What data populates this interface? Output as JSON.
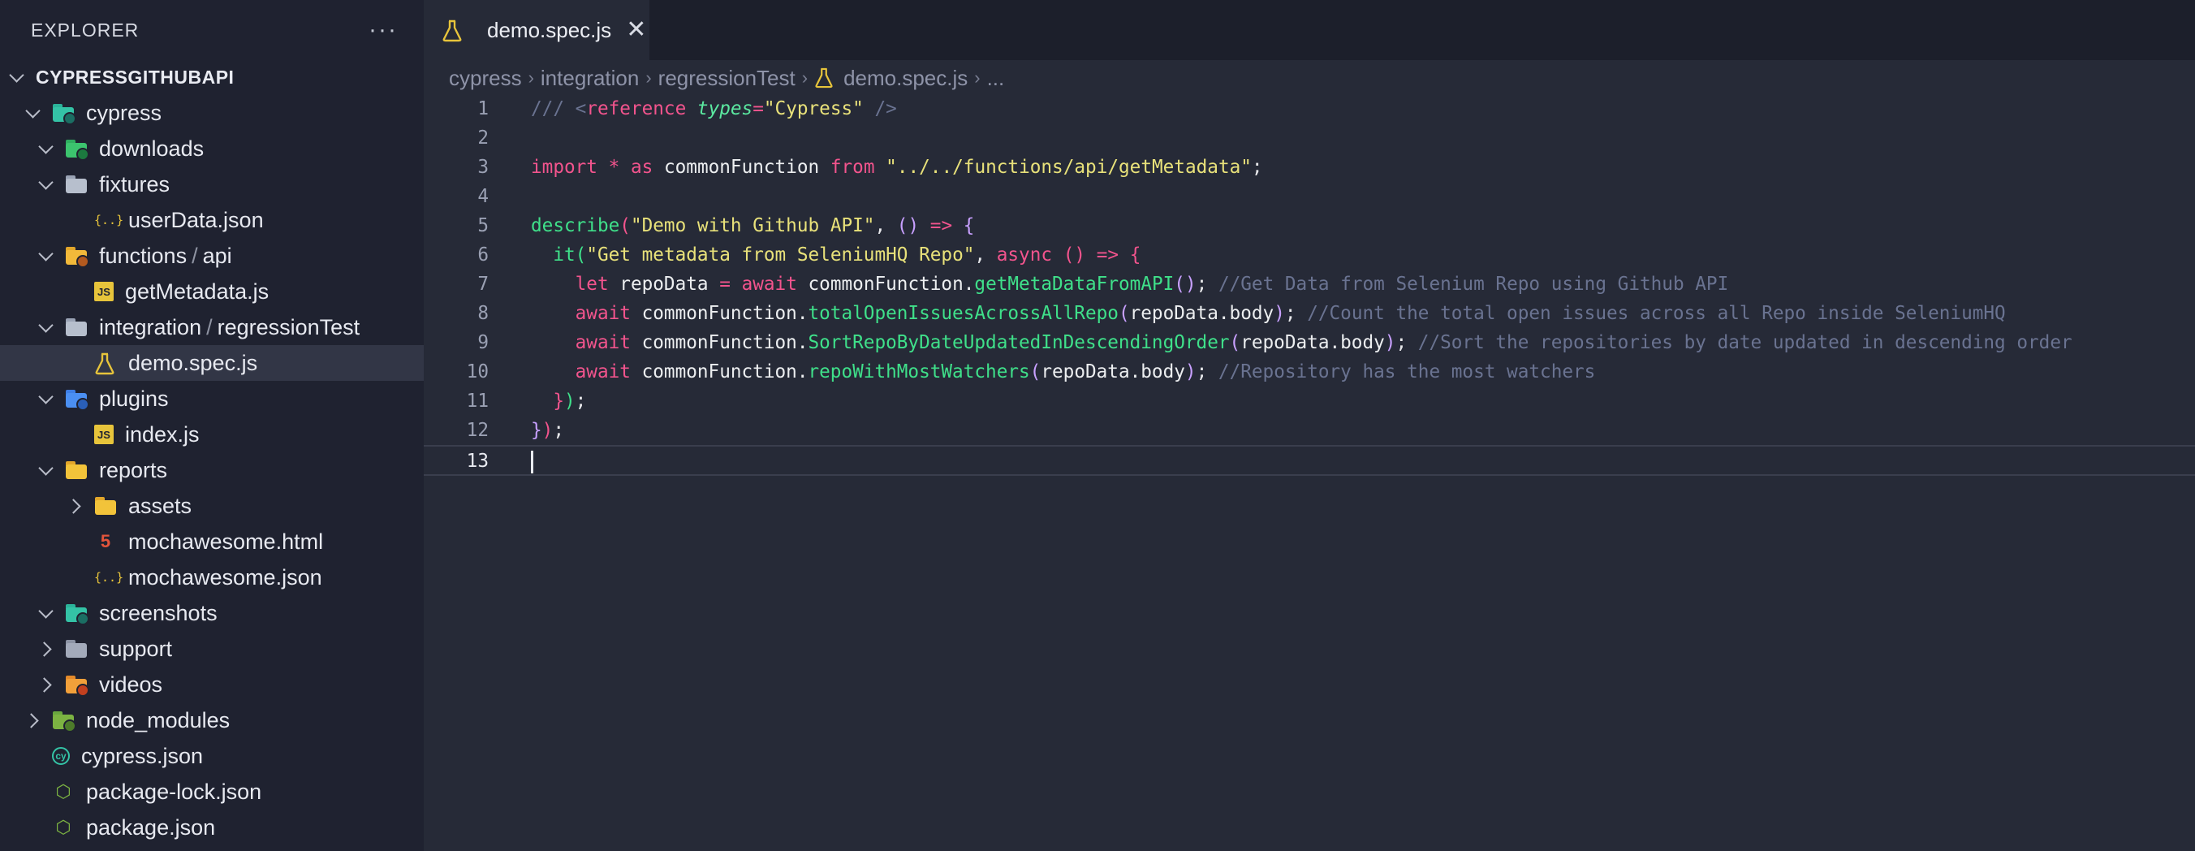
{
  "sidebar": {
    "title": "EXPLORER",
    "more": "···",
    "tree": [
      {
        "label": "CYPRESSGITHUBAPI",
        "depth": 0,
        "chevron": "down",
        "icon": "none",
        "root": true
      },
      {
        "label": "cypress",
        "depth": 1,
        "chevron": "down",
        "icon": "folder-cypress-icon"
      },
      {
        "label": "downloads",
        "depth": 2,
        "chevron": "down",
        "icon": "folder-downloads-icon"
      },
      {
        "label": "fixtures",
        "depth": 2,
        "chevron": "down",
        "icon": "folder-icon"
      },
      {
        "label": "userData.json",
        "depth": 3,
        "chevron": "none",
        "icon": "json-icon"
      },
      {
        "label": "functions",
        "label2": "api",
        "depth": 2,
        "chevron": "down",
        "icon": "folder-functions-icon"
      },
      {
        "label": "getMetadata.js",
        "depth": 3,
        "chevron": "none",
        "icon": "js-icon"
      },
      {
        "label": "integration",
        "label2": "regressionTest",
        "depth": 2,
        "chevron": "down",
        "icon": "folder-icon"
      },
      {
        "label": "demo.spec.js",
        "depth": 3,
        "chevron": "none",
        "icon": "flask-icon",
        "selected": true
      },
      {
        "label": "plugins",
        "depth": 2,
        "chevron": "down",
        "icon": "folder-plugins-icon"
      },
      {
        "label": "index.js",
        "depth": 3,
        "chevron": "none",
        "icon": "js-icon"
      },
      {
        "label": "reports",
        "depth": 2,
        "chevron": "down",
        "icon": "folder-reports-icon"
      },
      {
        "label": "assets",
        "depth": 3,
        "chevron": "right",
        "icon": "folder-assets-icon"
      },
      {
        "label": "mochawesome.html",
        "depth": 3,
        "chevron": "none",
        "icon": "html-icon"
      },
      {
        "label": "mochawesome.json",
        "depth": 3,
        "chevron": "none",
        "icon": "json-icon"
      },
      {
        "label": "screenshots",
        "depth": 2,
        "chevron": "down",
        "icon": "folder-screenshots-icon"
      },
      {
        "label": "support",
        "depth": 2,
        "chevron": "right",
        "icon": "folder-support-icon"
      },
      {
        "label": "videos",
        "depth": 2,
        "chevron": "right",
        "icon": "folder-videos-icon"
      },
      {
        "label": "node_modules",
        "depth": 1,
        "chevron": "right",
        "icon": "folder-node-icon"
      },
      {
        "label": "cypress.json",
        "depth": 1,
        "chevron": "none",
        "icon": "cypress-icon"
      },
      {
        "label": "package-lock.json",
        "depth": 1,
        "chevron": "none",
        "icon": "nodejs-icon"
      },
      {
        "label": "package.json",
        "depth": 1,
        "chevron": "none",
        "icon": "nodejs-icon"
      }
    ]
  },
  "tab": {
    "label": "demo.spec.js",
    "close": "✕"
  },
  "breadcrumb": [
    "cypress",
    "integration",
    "regressionTest",
    "demo.spec.js",
    "..."
  ],
  "code": {
    "line_numbers": [
      "1",
      "2",
      "3",
      "4",
      "5",
      "6",
      "7",
      "8",
      "9",
      "10",
      "11",
      "12",
      "13"
    ],
    "lines": [
      [
        [
          "c-cm",
          "/// "
        ],
        [
          "c-cm",
          "<"
        ],
        [
          "c-tag",
          "reference"
        ],
        [
          "c-pun",
          " "
        ],
        [
          "c-attr",
          "types"
        ],
        [
          "c-kw",
          "="
        ],
        [
          "c-str",
          "\"Cypress\""
        ],
        [
          "c-cm",
          " />"
        ]
      ],
      [],
      [
        [
          "c-kw",
          "import"
        ],
        [
          "c-pun",
          " "
        ],
        [
          "c-kw",
          "*"
        ],
        [
          "c-pun",
          " "
        ],
        [
          "c-kw",
          "as"
        ],
        [
          "c-id",
          " commonFunction "
        ],
        [
          "c-kw",
          "from"
        ],
        [
          "c-pun",
          " "
        ],
        [
          "c-str",
          "\"../../functions/api/getMetadata\""
        ],
        [
          "c-pun",
          ";"
        ]
      ],
      [],
      [
        [
          "c-fn",
          "describe"
        ],
        [
          "c-br1",
          "("
        ],
        [
          "c-str",
          "\"Demo with Github API\""
        ],
        [
          "c-pun",
          ", "
        ],
        [
          "c-br2",
          "()"
        ],
        [
          "c-pun",
          " "
        ],
        [
          "c-kw",
          "=>"
        ],
        [
          "c-pun",
          " "
        ],
        [
          "c-br2",
          "{"
        ]
      ],
      [
        [
          "c-pun",
          "  "
        ],
        [
          "c-fn",
          "it"
        ],
        [
          "c-br3",
          "("
        ],
        [
          "c-str",
          "\"Get metadata from SeleniumHQ Repo\""
        ],
        [
          "c-pun",
          ", "
        ],
        [
          "c-kw",
          "async"
        ],
        [
          "c-pun",
          " "
        ],
        [
          "c-br1",
          "()"
        ],
        [
          "c-pun",
          " "
        ],
        [
          "c-kw",
          "=>"
        ],
        [
          "c-pun",
          " "
        ],
        [
          "c-br1",
          "{"
        ]
      ],
      [
        [
          "c-pun",
          "    "
        ],
        [
          "c-kw",
          "let"
        ],
        [
          "c-id",
          " repoData "
        ],
        [
          "c-kw",
          "="
        ],
        [
          "c-pun",
          " "
        ],
        [
          "c-kw",
          "await"
        ],
        [
          "c-id",
          " commonFunction."
        ],
        [
          "c-fn",
          "getMetaDataFromAPI"
        ],
        [
          "c-br2",
          "()"
        ],
        [
          "c-pun",
          "; "
        ],
        [
          "c-cm",
          "//Get Data from Selenium Repo using Github API"
        ]
      ],
      [
        [
          "c-pun",
          "    "
        ],
        [
          "c-kw",
          "await"
        ],
        [
          "c-id",
          " commonFunction."
        ],
        [
          "c-fn",
          "totalOpenIssuesAcrossAllRepo"
        ],
        [
          "c-br2",
          "("
        ],
        [
          "c-id",
          "repoData.body"
        ],
        [
          "c-br2",
          ")"
        ],
        [
          "c-pun",
          "; "
        ],
        [
          "c-cm",
          "//Count the total open issues across all Repo inside SeleniumHQ"
        ]
      ],
      [
        [
          "c-pun",
          "    "
        ],
        [
          "c-kw",
          "await"
        ],
        [
          "c-id",
          " commonFunction."
        ],
        [
          "c-fn",
          "SortRepoByDateUpdatedInDescendingOrder"
        ],
        [
          "c-br2",
          "("
        ],
        [
          "c-id",
          "repoData.body"
        ],
        [
          "c-br2",
          ")"
        ],
        [
          "c-pun",
          "; "
        ],
        [
          "c-cm",
          "//Sort the repositories by date updated in descending order"
        ]
      ],
      [
        [
          "c-pun",
          "    "
        ],
        [
          "c-kw",
          "await"
        ],
        [
          "c-id",
          " commonFunction."
        ],
        [
          "c-fn",
          "repoWithMostWatchers"
        ],
        [
          "c-br2",
          "("
        ],
        [
          "c-id",
          "repoData.body"
        ],
        [
          "c-br2",
          ")"
        ],
        [
          "c-pun",
          "; "
        ],
        [
          "c-cm",
          "//Repository has the most watchers"
        ]
      ],
      [
        [
          "c-pun",
          "  "
        ],
        [
          "c-br1",
          "}"
        ],
        [
          "c-br3",
          ")"
        ],
        [
          "c-pun",
          ";"
        ]
      ],
      [
        [
          "c-br2",
          "}"
        ],
        [
          "c-br1",
          ")"
        ],
        [
          "c-pun",
          ";"
        ]
      ],
      []
    ]
  }
}
